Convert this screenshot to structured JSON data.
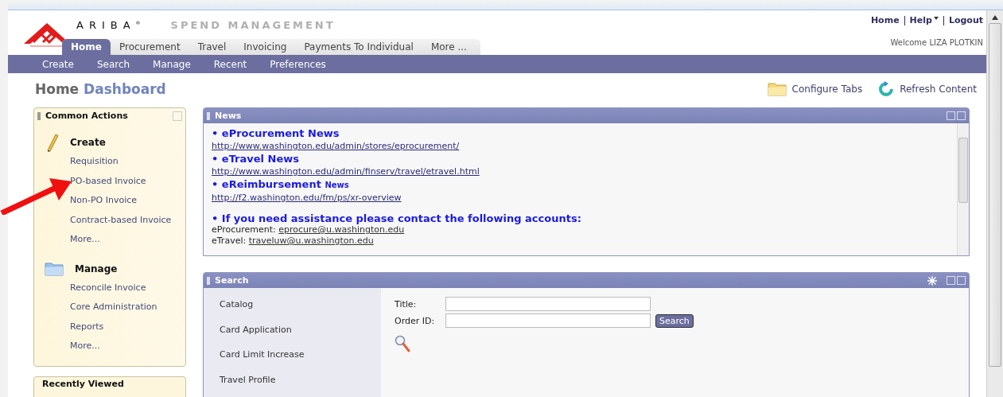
{
  "brand": {
    "name": "ARIBA",
    "mark": "®",
    "product": "SPEND MANAGEMENT"
  },
  "tabs": [
    {
      "label": "Home",
      "selected": true
    },
    {
      "label": "Procurement",
      "selected": false
    },
    {
      "label": "Travel",
      "selected": false
    },
    {
      "label": "Invoicing",
      "selected": false
    },
    {
      "label": "Payments To Individual",
      "selected": false
    },
    {
      "label": "More ...",
      "selected": false
    }
  ],
  "top_links": [
    {
      "label": "Home",
      "dropdown": false
    },
    {
      "label": "Help",
      "dropdown": true
    },
    {
      "label": "Logout",
      "dropdown": false
    }
  ],
  "welcome": "Welcome LIZA PLOTKIN",
  "subnav": [
    "Create",
    "Search",
    "Manage",
    "Recent",
    "Preferences"
  ],
  "page_title": {
    "first": "Home",
    "second": "Dashboard"
  },
  "page_actions": [
    {
      "kind": "folder",
      "label": "Configure Tabs"
    },
    {
      "kind": "refresh",
      "label": "Refresh Content"
    }
  ],
  "common_actions": {
    "title": "Common Actions",
    "groups": [
      {
        "kind": "pencil",
        "title": "Create",
        "items": [
          "Requisition",
          "PO-based Invoice",
          "Non-PO Invoice",
          "Contract-based Invoice",
          "More..."
        ]
      },
      {
        "kind": "folder",
        "title": "Manage",
        "items": [
          "Reconcile Invoice",
          "Core Administration",
          "Reports",
          "More..."
        ]
      }
    ]
  },
  "recently_viewed": {
    "title": "Recently Viewed"
  },
  "news": {
    "title": "News",
    "bullet": "•",
    "entries": [
      {
        "kind": "heading",
        "text": "eProcurement News"
      },
      {
        "kind": "link",
        "text": "http://www.washington.edu/admin/stores/eprocurement/"
      },
      {
        "kind": "heading",
        "text": "eTravel News"
      },
      {
        "kind": "link",
        "text": "http://www.washington.edu/admin/finserv/travel/etravel.html"
      },
      {
        "kind": "heading",
        "text": "eReimbursement **News**"
      },
      {
        "kind": "link",
        "text": "http://f2.washington.edu/fm/ps/xr-overview"
      },
      {
        "kind": "gap"
      },
      {
        "kind": "heading",
        "text": "If you need assistance please contact the following accounts:"
      },
      {
        "kind": "contact",
        "text": "eProcurement:",
        "link": "eprocure@u.washington.edu"
      },
      {
        "kind": "contact",
        "text": "eTravel:",
        "link": "traveluw@u.washington.edu"
      }
    ]
  },
  "search": {
    "title": "Search",
    "categories": [
      "Catalog",
      "Card Application",
      "Card Limit Increase",
      "Travel Profile"
    ],
    "fields": [
      {
        "label": "Title:"
      },
      {
        "label": "Order ID:"
      }
    ],
    "button": "Search"
  }
}
